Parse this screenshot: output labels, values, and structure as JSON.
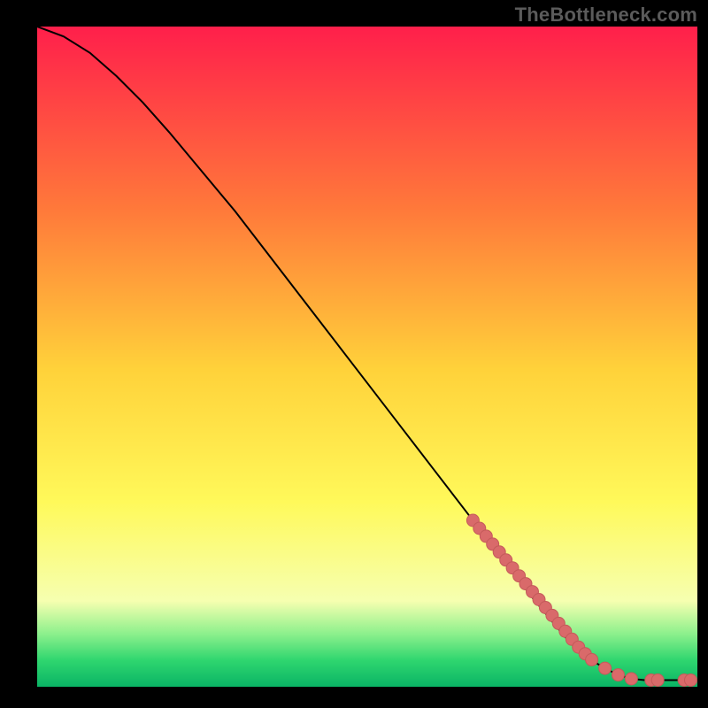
{
  "attribution": "TheBottleneck.com",
  "colors": {
    "marker_fill": "#d96a6a",
    "marker_stroke": "#c45a5a",
    "curve": "#000000",
    "frame": "#000000",
    "gradient_top": "#ff1f4b",
    "gradient_mid1": "#ff7a3a",
    "gradient_mid2": "#ffd23a",
    "gradient_mid3": "#fff95a",
    "gradient_low": "#f6ffb0",
    "gradient_green1": "#8cf08c",
    "gradient_green2": "#2fd66f",
    "gradient_green3": "#0ab465"
  },
  "chart_data": {
    "type": "line",
    "title": "",
    "xlabel": "",
    "ylabel": "",
    "xlim": [
      0,
      100
    ],
    "ylim": [
      0,
      100
    ],
    "series": [
      {
        "name": "curve",
        "x": [
          0,
          4,
          8,
          12,
          16,
          20,
          25,
          30,
          35,
          40,
          45,
          50,
          55,
          60,
          65,
          70,
          75,
          80,
          82,
          84,
          86,
          88,
          90,
          92,
          94,
          96,
          98,
          100
        ],
        "y": [
          100,
          98.5,
          96,
          92.5,
          88.5,
          84,
          78,
          72,
          65.5,
          59,
          52.5,
          46,
          39.5,
          33,
          26.5,
          20,
          13.5,
          7.5,
          5.5,
          4,
          2.8,
          1.8,
          1.2,
          1.0,
          1.0,
          1.0,
          1.0,
          1.0
        ]
      }
    ],
    "markers": {
      "name": "highlight-points",
      "x": [
        66,
        67,
        68,
        69,
        70,
        71,
        72,
        73,
        74,
        75,
        76,
        77,
        78,
        79,
        80,
        81,
        82,
        83,
        84,
        86,
        88,
        90,
        93,
        94,
        98,
        99
      ],
      "y": [
        25.2,
        24.0,
        22.8,
        21.6,
        20.4,
        19.2,
        18.0,
        16.8,
        15.6,
        14.4,
        13.2,
        12.0,
        10.8,
        9.6,
        8.4,
        7.2,
        6.0,
        5.0,
        4.1,
        2.8,
        1.8,
        1.2,
        1.0,
        1.0,
        1.0,
        1.0
      ]
    }
  }
}
